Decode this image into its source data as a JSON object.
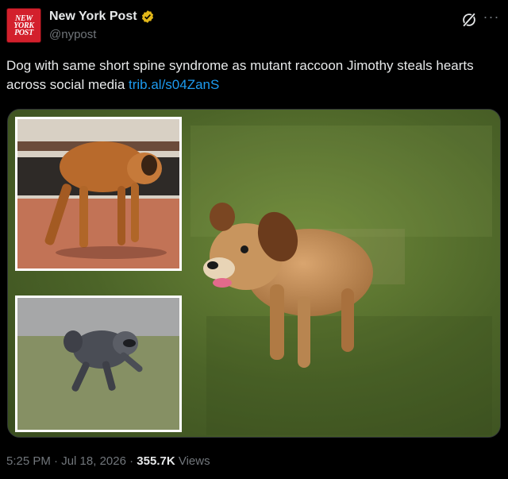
{
  "account": {
    "logo_text": "NEW\nYORK\nPOST",
    "display_name": "New York Post",
    "handle": "@nypost",
    "verified_badge": "gold-verified-badge-icon"
  },
  "tweet": {
    "text": "Dog with same short spine syndrome as mutant raccoon Jimothy steals hearts across social media",
    "link_text": "trib.al/s04ZanS"
  },
  "media": {
    "description_icons": [
      "main-dog-photo",
      "inset-dog-photo",
      "inset-raccoon-photo"
    ]
  },
  "meta": {
    "time": "5:25 PM",
    "sep1": "·",
    "date": "Jul 18, 2026",
    "sep2": "·",
    "views_count": "355.7K",
    "views_label": "Views"
  },
  "colors": {
    "background": "#000000",
    "text": "#e7e9ea",
    "muted": "#71767b",
    "link": "#1d9bf0",
    "brand": "#d3202c",
    "verified": "#e2b719"
  }
}
